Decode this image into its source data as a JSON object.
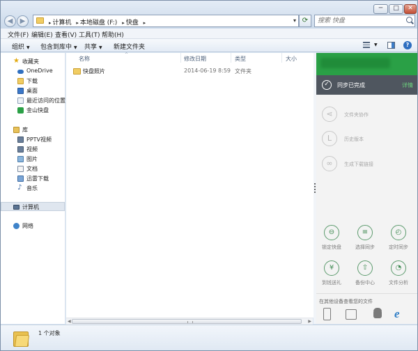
{
  "window": {
    "minimize_label": "─",
    "maximize_label": "□",
    "close_label": "✕"
  },
  "address": {
    "crumbs": [
      "计算机",
      "本地磁盘 (F:)",
      "快盘"
    ],
    "separator": "▸"
  },
  "search": {
    "placeholder": "搜索 快盘"
  },
  "menu": [
    "文件(F)",
    "编辑(E)",
    "查看(V)",
    "工具(T)",
    "帮助(H)"
  ],
  "toolbar": {
    "organize": "组织",
    "include_library": "包含到库中",
    "share": "共享",
    "new_folder": "新建文件夹"
  },
  "nav": {
    "favorites": "收藏夹",
    "onedrive": "OneDrive",
    "downloads": "下载",
    "desktop": "桌面",
    "recent": "最近访问的位置",
    "jinshan": "金山快盘",
    "library": "库",
    "pptv": "PPTV视频",
    "video": "视频",
    "pictures": "图片",
    "documents": "文档",
    "thunder": "迅雷下载",
    "music": "音乐",
    "computer": "计算机",
    "network": "网络"
  },
  "columns": {
    "name": "名称",
    "date": "修改日期",
    "type": "类型",
    "size": "大小"
  },
  "files": [
    {
      "name": "快盘照片",
      "date": "2014-06-19 8:59",
      "type": "文件夹"
    }
  ],
  "sync_panel": {
    "status": "同步已完成",
    "details": "详情",
    "features": [
      "文件夹协作",
      "历史版本",
      "生成下载链接"
    ],
    "actions": [
      "锁定快盘",
      "选择同步",
      "定时同步",
      "到钱送礼",
      "备份中心",
      "文件分析"
    ],
    "other_devices": "在其他设备查看您的文件"
  },
  "statusbar": {
    "count": "1 个对象"
  },
  "colors": {
    "sync_green": "#2aa046",
    "sync_status_bg": "#4f565f",
    "details_green": "#6dd47e"
  }
}
